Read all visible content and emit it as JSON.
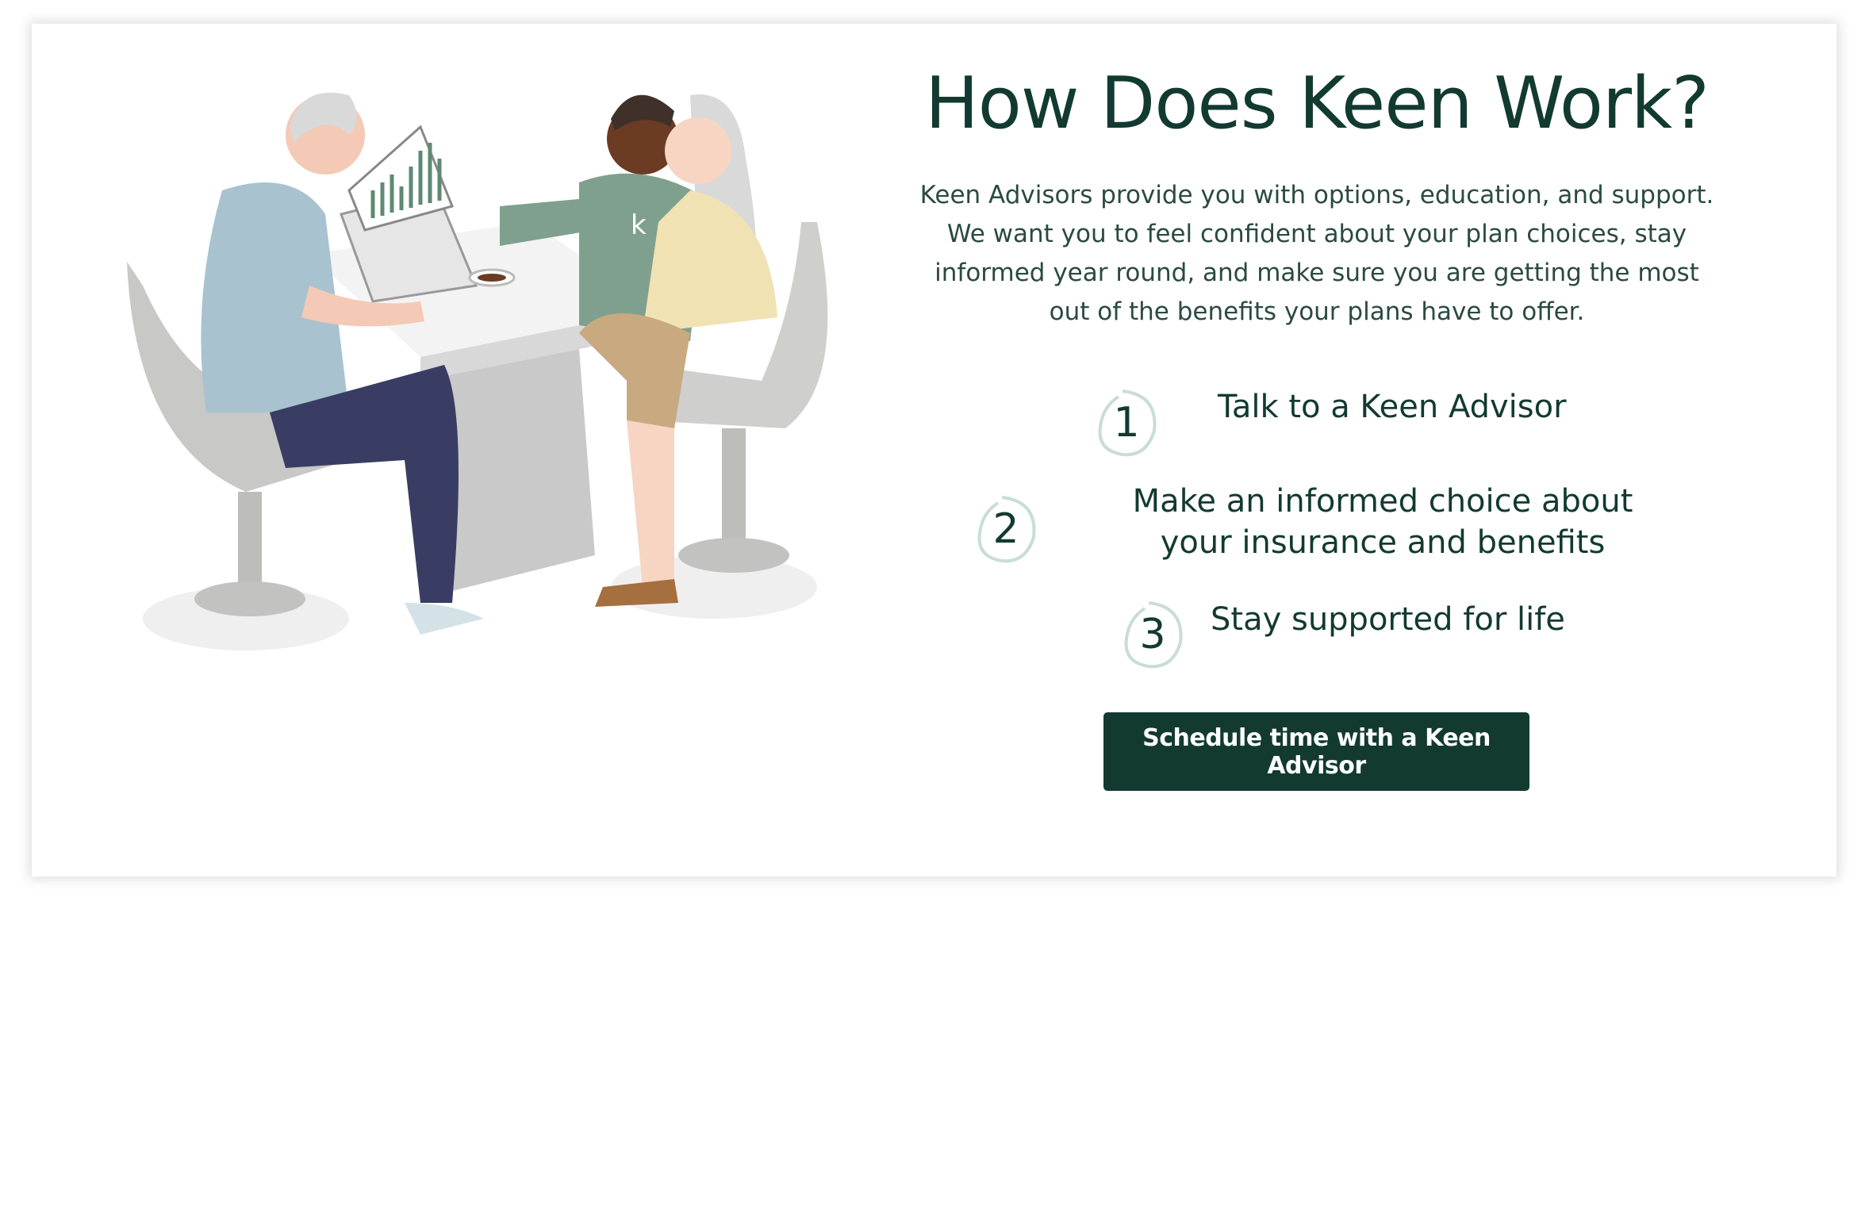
{
  "section": {
    "title": "How Does Keen Work?",
    "description": "Keen Advisors provide you with options, education, and support. We want you to feel confident about your plan choices, stay informed year round, and make sure you are getting the most out of the benefits your plans have to offer.",
    "steps": [
      {
        "number": "1",
        "label": "Talk to a Keen Advisor"
      },
      {
        "number": "2",
        "label": "Make an informed choice about your insurance and benefits"
      },
      {
        "number": "3",
        "label": "Stay supported for life"
      }
    ],
    "cta_label": "Schedule time with a Keen Advisor",
    "illustration": {
      "logo_letter": "k"
    }
  },
  "colors": {
    "brand_dark_green": "#123a30",
    "step_ring": "#c9ddd4"
  }
}
